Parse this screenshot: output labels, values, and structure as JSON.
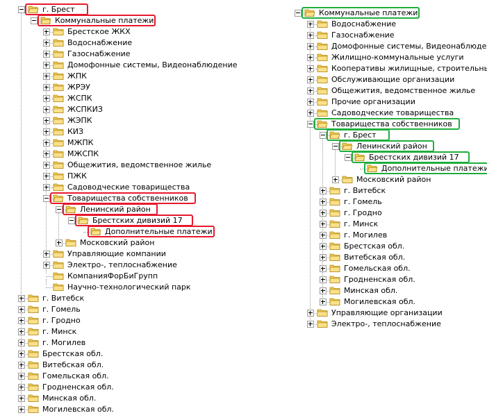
{
  "colors": {
    "highlight_left": "#e8192c",
    "highlight_right": "#1fae3d",
    "folder": "#f2c94c",
    "folder_outline": "#b08a1e"
  },
  "icons": {
    "folder": "folder-icon",
    "open_folder": "folder-open-icon",
    "expander": "expander-icon"
  },
  "left_tree": [
    {
      "label": "г. Брест",
      "depth": 0,
      "state": "minus",
      "open": true
    },
    {
      "label": "Коммунальные платежи",
      "depth": 1,
      "state": "minus",
      "open": true
    },
    {
      "label": "Брестское ЖКХ",
      "depth": 2,
      "state": "plus"
    },
    {
      "label": "Водоснабжение",
      "depth": 2,
      "state": "plus"
    },
    {
      "label": "Газоснабжение",
      "depth": 2,
      "state": "plus"
    },
    {
      "label": "Домофонные системы, Видеонаблюдение",
      "depth": 2,
      "state": "plus"
    },
    {
      "label": "ЖПК",
      "depth": 2,
      "state": "plus"
    },
    {
      "label": "ЖРЭУ",
      "depth": 2,
      "state": "plus"
    },
    {
      "label": "ЖСПК",
      "depth": 2,
      "state": "plus"
    },
    {
      "label": "ЖСПКИЗ",
      "depth": 2,
      "state": "plus"
    },
    {
      "label": "ЖЭПК",
      "depth": 2,
      "state": "plus"
    },
    {
      "label": "КИЗ",
      "depth": 2,
      "state": "plus"
    },
    {
      "label": "МЖПК",
      "depth": 2,
      "state": "plus"
    },
    {
      "label": "МЖСПК",
      "depth": 2,
      "state": "plus"
    },
    {
      "label": "Общежития, ведомственное жилье",
      "depth": 2,
      "state": "plus"
    },
    {
      "label": "ПЖК",
      "depth": 2,
      "state": "plus"
    },
    {
      "label": "Садоводческие товарищества",
      "depth": 2,
      "state": "plus"
    },
    {
      "label": "Товарищества собственников",
      "depth": 2,
      "state": "minus",
      "open": true
    },
    {
      "label": "Ленинский район",
      "depth": 3,
      "state": "minus",
      "open": true
    },
    {
      "label": "Брестских дивизий 17",
      "depth": 4,
      "state": "minus",
      "open": true
    },
    {
      "label": "Дополнительные платежи",
      "depth": 5,
      "state": "none",
      "open": true
    },
    {
      "label": "Московский район",
      "depth": 3,
      "state": "plus"
    },
    {
      "label": "Управляющие компании",
      "depth": 2,
      "state": "plus"
    },
    {
      "label": "Электро-, теплоснабжение",
      "depth": 2,
      "state": "plus"
    },
    {
      "label": "КомпанияФорБиГрупп",
      "depth": 2,
      "state": "none"
    },
    {
      "label": "Научно-технологический парк",
      "depth": 2,
      "state": "none"
    },
    {
      "label": "г. Витебск",
      "depth": 0,
      "state": "plus"
    },
    {
      "label": "г. Гомель",
      "depth": 0,
      "state": "plus"
    },
    {
      "label": "г. Гродно",
      "depth": 0,
      "state": "plus"
    },
    {
      "label": "г. Минск",
      "depth": 0,
      "state": "plus"
    },
    {
      "label": "г. Могилев",
      "depth": 0,
      "state": "plus"
    },
    {
      "label": "Брестская обл.",
      "depth": 0,
      "state": "plus"
    },
    {
      "label": "Витебская обл.",
      "depth": 0,
      "state": "plus"
    },
    {
      "label": "Гомельская обл.",
      "depth": 0,
      "state": "plus"
    },
    {
      "label": "Гродненская обл.",
      "depth": 0,
      "state": "plus"
    },
    {
      "label": "Минская обл.",
      "depth": 0,
      "state": "plus"
    },
    {
      "label": "Могилевская обл.",
      "depth": 0,
      "state": "plus"
    }
  ],
  "right_tree": [
    {
      "label": "Коммунальные платежи",
      "depth": 0,
      "state": "minus",
      "open": true
    },
    {
      "label": "Водоснабжение",
      "depth": 1,
      "state": "plus"
    },
    {
      "label": "Газоснабжение",
      "depth": 1,
      "state": "plus"
    },
    {
      "label": "Домофонные системы, Видеонаблюдение",
      "depth": 1,
      "state": "plus"
    },
    {
      "label": "Жилищно-коммунальные услуги",
      "depth": 1,
      "state": "plus"
    },
    {
      "label": "Кооперативы жилищные, строительные",
      "depth": 1,
      "state": "plus"
    },
    {
      "label": "Обслуживающие организации",
      "depth": 1,
      "state": "plus"
    },
    {
      "label": "Общежития, ведомственное жилье",
      "depth": 1,
      "state": "plus"
    },
    {
      "label": "Прочие организации",
      "depth": 1,
      "state": "plus"
    },
    {
      "label": "Садоводческие товарищества",
      "depth": 1,
      "state": "plus"
    },
    {
      "label": "Товарищества собственников",
      "depth": 1,
      "state": "minus",
      "open": true
    },
    {
      "label": "г. Брест",
      "depth": 2,
      "state": "minus",
      "open": true
    },
    {
      "label": "Ленинский район",
      "depth": 3,
      "state": "minus",
      "open": true
    },
    {
      "label": "Брестских дивизий 17",
      "depth": 4,
      "state": "minus",
      "open": true
    },
    {
      "label": "Дополнительные платежи",
      "depth": 5,
      "state": "none",
      "open": true
    },
    {
      "label": "Московский район",
      "depth": 3,
      "state": "plus"
    },
    {
      "label": "г. Витебск",
      "depth": 2,
      "state": "plus"
    },
    {
      "label": "г. Гомель",
      "depth": 2,
      "state": "plus"
    },
    {
      "label": "г. Гродно",
      "depth": 2,
      "state": "plus"
    },
    {
      "label": "г. Минск",
      "depth": 2,
      "state": "plus"
    },
    {
      "label": "г. Могилев",
      "depth": 2,
      "state": "plus"
    },
    {
      "label": "Брестская обл.",
      "depth": 2,
      "state": "plus"
    },
    {
      "label": "Витебская обл.",
      "depth": 2,
      "state": "plus"
    },
    {
      "label": "Гомельская обл.",
      "depth": 2,
      "state": "plus"
    },
    {
      "label": "Гродненская обл.",
      "depth": 2,
      "state": "plus"
    },
    {
      "label": "Минская обл.",
      "depth": 2,
      "state": "plus"
    },
    {
      "label": "Могилевская обл.",
      "depth": 2,
      "state": "plus"
    },
    {
      "label": "Управляющие организации",
      "depth": 1,
      "state": "plus"
    },
    {
      "label": "Электро-, теплоснабжение",
      "depth": 1,
      "state": "plus"
    }
  ],
  "highlighted_left": [
    "г. Брест",
    "Коммунальные платежи",
    "Товарищества собственников",
    "Ленинский район",
    "Брестских дивизий 17",
    "Дополнительные платежи"
  ],
  "highlighted_right": [
    "Коммунальные платежи",
    "Товарищества собственников",
    "г. Брест",
    "Ленинский район",
    "Брестских дивизий 17",
    "Дополнительные платежи"
  ]
}
